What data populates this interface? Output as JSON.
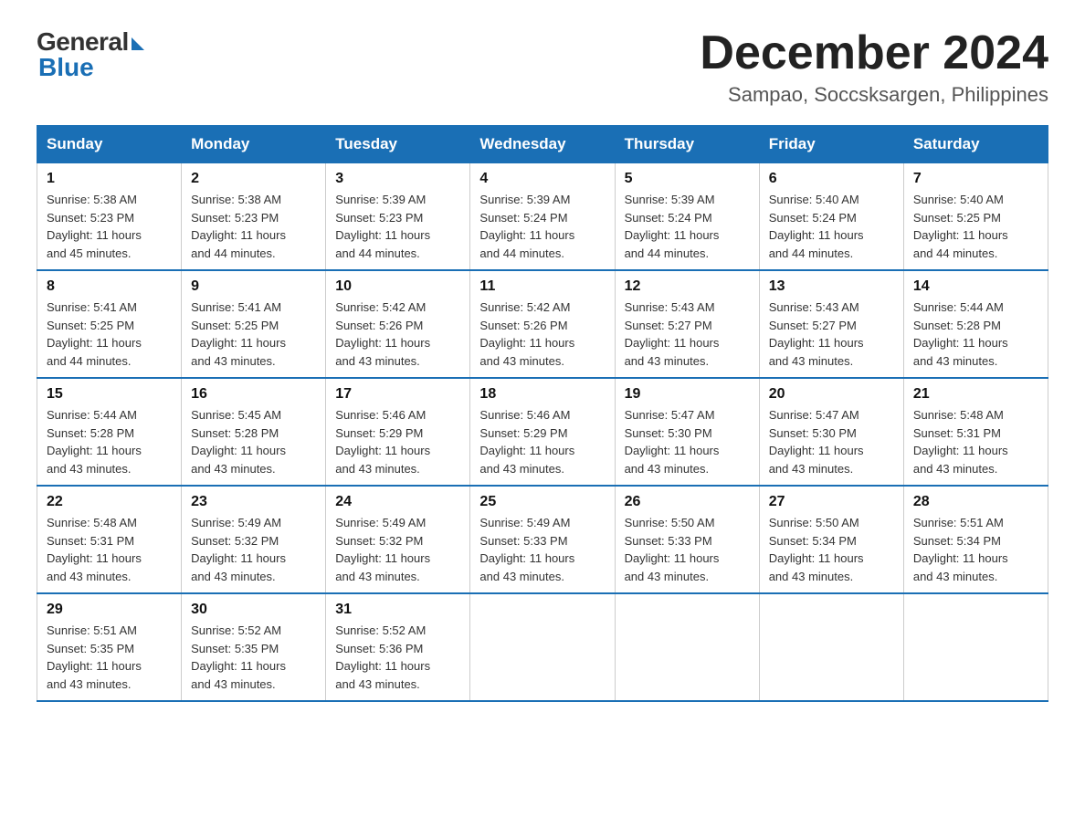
{
  "logo": {
    "general": "General",
    "blue": "Blue",
    "arrow": true
  },
  "title": "December 2024",
  "location": "Sampao, Soccsksargen, Philippines",
  "headers": [
    "Sunday",
    "Monday",
    "Tuesday",
    "Wednesday",
    "Thursday",
    "Friday",
    "Saturday"
  ],
  "weeks": [
    [
      {
        "day": "1",
        "sunrise": "5:38 AM",
        "sunset": "5:23 PM",
        "daylight": "11 hours and 45 minutes."
      },
      {
        "day": "2",
        "sunrise": "5:38 AM",
        "sunset": "5:23 PM",
        "daylight": "11 hours and 44 minutes."
      },
      {
        "day": "3",
        "sunrise": "5:39 AM",
        "sunset": "5:23 PM",
        "daylight": "11 hours and 44 minutes."
      },
      {
        "day": "4",
        "sunrise": "5:39 AM",
        "sunset": "5:24 PM",
        "daylight": "11 hours and 44 minutes."
      },
      {
        "day": "5",
        "sunrise": "5:39 AM",
        "sunset": "5:24 PM",
        "daylight": "11 hours and 44 minutes."
      },
      {
        "day": "6",
        "sunrise": "5:40 AM",
        "sunset": "5:24 PM",
        "daylight": "11 hours and 44 minutes."
      },
      {
        "day": "7",
        "sunrise": "5:40 AM",
        "sunset": "5:25 PM",
        "daylight": "11 hours and 44 minutes."
      }
    ],
    [
      {
        "day": "8",
        "sunrise": "5:41 AM",
        "sunset": "5:25 PM",
        "daylight": "11 hours and 44 minutes."
      },
      {
        "day": "9",
        "sunrise": "5:41 AM",
        "sunset": "5:25 PM",
        "daylight": "11 hours and 43 minutes."
      },
      {
        "day": "10",
        "sunrise": "5:42 AM",
        "sunset": "5:26 PM",
        "daylight": "11 hours and 43 minutes."
      },
      {
        "day": "11",
        "sunrise": "5:42 AM",
        "sunset": "5:26 PM",
        "daylight": "11 hours and 43 minutes."
      },
      {
        "day": "12",
        "sunrise": "5:43 AM",
        "sunset": "5:27 PM",
        "daylight": "11 hours and 43 minutes."
      },
      {
        "day": "13",
        "sunrise": "5:43 AM",
        "sunset": "5:27 PM",
        "daylight": "11 hours and 43 minutes."
      },
      {
        "day": "14",
        "sunrise": "5:44 AM",
        "sunset": "5:28 PM",
        "daylight": "11 hours and 43 minutes."
      }
    ],
    [
      {
        "day": "15",
        "sunrise": "5:44 AM",
        "sunset": "5:28 PM",
        "daylight": "11 hours and 43 minutes."
      },
      {
        "day": "16",
        "sunrise": "5:45 AM",
        "sunset": "5:28 PM",
        "daylight": "11 hours and 43 minutes."
      },
      {
        "day": "17",
        "sunrise": "5:46 AM",
        "sunset": "5:29 PM",
        "daylight": "11 hours and 43 minutes."
      },
      {
        "day": "18",
        "sunrise": "5:46 AM",
        "sunset": "5:29 PM",
        "daylight": "11 hours and 43 minutes."
      },
      {
        "day": "19",
        "sunrise": "5:47 AM",
        "sunset": "5:30 PM",
        "daylight": "11 hours and 43 minutes."
      },
      {
        "day": "20",
        "sunrise": "5:47 AM",
        "sunset": "5:30 PM",
        "daylight": "11 hours and 43 minutes."
      },
      {
        "day": "21",
        "sunrise": "5:48 AM",
        "sunset": "5:31 PM",
        "daylight": "11 hours and 43 minutes."
      }
    ],
    [
      {
        "day": "22",
        "sunrise": "5:48 AM",
        "sunset": "5:31 PM",
        "daylight": "11 hours and 43 minutes."
      },
      {
        "day": "23",
        "sunrise": "5:49 AM",
        "sunset": "5:32 PM",
        "daylight": "11 hours and 43 minutes."
      },
      {
        "day": "24",
        "sunrise": "5:49 AM",
        "sunset": "5:32 PM",
        "daylight": "11 hours and 43 minutes."
      },
      {
        "day": "25",
        "sunrise": "5:49 AM",
        "sunset": "5:33 PM",
        "daylight": "11 hours and 43 minutes."
      },
      {
        "day": "26",
        "sunrise": "5:50 AM",
        "sunset": "5:33 PM",
        "daylight": "11 hours and 43 minutes."
      },
      {
        "day": "27",
        "sunrise": "5:50 AM",
        "sunset": "5:34 PM",
        "daylight": "11 hours and 43 minutes."
      },
      {
        "day": "28",
        "sunrise": "5:51 AM",
        "sunset": "5:34 PM",
        "daylight": "11 hours and 43 minutes."
      }
    ],
    [
      {
        "day": "29",
        "sunrise": "5:51 AM",
        "sunset": "5:35 PM",
        "daylight": "11 hours and 43 minutes."
      },
      {
        "day": "30",
        "sunrise": "5:52 AM",
        "sunset": "5:35 PM",
        "daylight": "11 hours and 43 minutes."
      },
      {
        "day": "31",
        "sunrise": "5:52 AM",
        "sunset": "5:36 PM",
        "daylight": "11 hours and 43 minutes."
      },
      null,
      null,
      null,
      null
    ]
  ],
  "labels": {
    "sunrise": "Sunrise:",
    "sunset": "Sunset:",
    "daylight": "Daylight:"
  }
}
